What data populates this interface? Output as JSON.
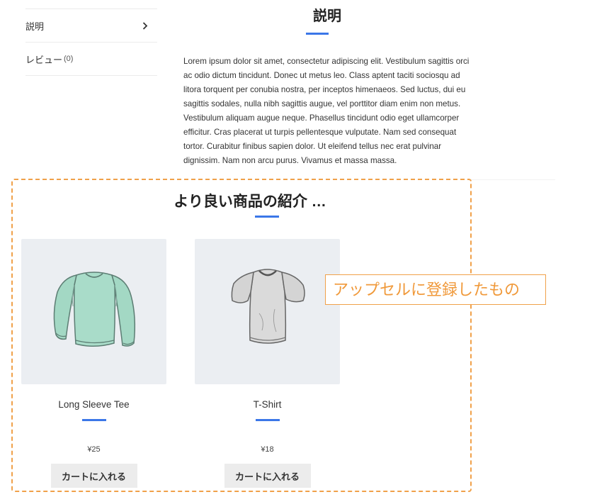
{
  "tabs": {
    "description_label": "説明",
    "reviews_label": "レビュー",
    "reviews_count": "(0)"
  },
  "description": {
    "title": "説明",
    "text": "Lorem ipsum dolor sit amet, consectetur adipiscing elit. Vestibulum sagittis orci ac odio dictum tincidunt. Donec ut metus leo. Class aptent taciti sociosqu ad litora torquent per conubia nostra, per inceptos himenaeos. Sed luctus, dui eu sagittis sodales, nulla nibh sagittis augue, vel porttitor diam enim non metus. Vestibulum aliquam augue neque. Phasellus tincidunt odio eget ullamcorper efficitur. Cras placerat ut turpis pellentesque vulputate. Nam sed consequat tortor. Curabitur finibus sapien dolor. Ut eleifend tellus nec erat pulvinar dignissim. Nam non arcu purus. Vivamus et massa massa."
  },
  "upsells": {
    "title": "より良い商品の紹介 …",
    "products": [
      {
        "name": "Long Sleeve Tee",
        "price": "¥25",
        "button_label": "カートに入れる",
        "icon": "long-sleeve-shirt-icon"
      },
      {
        "name": "T-Shirt",
        "price": "¥18",
        "button_label": "カートに入れる",
        "icon": "t-shirt-icon"
      }
    ]
  },
  "annotation": {
    "text": "アップセルに登録したもの"
  },
  "colors": {
    "accent_blue": "#3b77e8",
    "annotation_orange": "#f0a14a",
    "product_bg": "#ebeef2",
    "button_bg": "#ececec"
  }
}
